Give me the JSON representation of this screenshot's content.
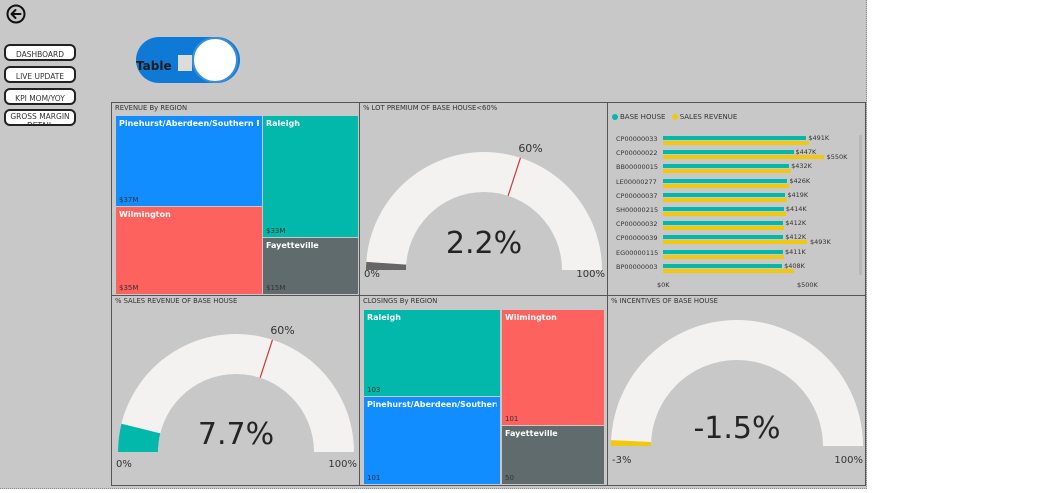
{
  "toggle": {
    "label": "Table"
  },
  "nav": [
    "DASHBOARD",
    "LIVE UPDATE",
    "KPI MOM/YOY",
    "GROSS MARGIN DETAIL"
  ],
  "revenue_by_region": {
    "title": "REVENUE By REGION",
    "tiles": [
      {
        "name": "Pinehurst/Aberdeen/Southern Pi...",
        "value": "$37M",
        "color": "#118dff"
      },
      {
        "name": "Raleigh",
        "value": "$33M",
        "color": "#01b8aa"
      },
      {
        "name": "Wilmington",
        "value": "$35M",
        "color": "#fd625e"
      },
      {
        "name": "Fayetteville",
        "value": "$15M",
        "color": "#5f6b6d"
      }
    ]
  },
  "lot_premium": {
    "title": "% LOT PREMIUM OF BASE HOUSE<60%",
    "value": "2.2%",
    "target": "60%",
    "min": "0%",
    "max": "100%",
    "fraction": 0.022,
    "target_fraction": 0.6,
    "fill": "#666666"
  },
  "sales_revenue_pct": {
    "title": "% SALES REVENUE OF BASE HOUSE",
    "value": "7.7%",
    "target": "60%",
    "min": "0%",
    "max": "100%",
    "fraction": 0.077,
    "target_fraction": 0.6,
    "fill": "#01b8aa"
  },
  "incentives": {
    "title": "% INCENTIVES OF BASE HOUSE",
    "value": "-1.5%",
    "min": "-3%",
    "max": "100%",
    "fraction": 0.015,
    "fill": "#f2c80f"
  },
  "closings_by_region": {
    "title": "CLOSINGS By REGION",
    "tiles": [
      {
        "name": "Raleigh",
        "value": "103",
        "color": "#01b8aa"
      },
      {
        "name": "Wilmington",
        "value": "101",
        "color": "#fd625e"
      },
      {
        "name": "Pinehurst/Aberdeen/Southern ...",
        "value": "101",
        "color": "#118dff"
      },
      {
        "name": "Fayetteville",
        "value": "50",
        "color": "#5f6b6d"
      }
    ]
  },
  "chart_data": {
    "type": "bar",
    "orientation": "horizontal",
    "legend_position": "top-left",
    "categories": [
      "CP00000033",
      "CP00000022",
      "BB00000015",
      "LE00000277",
      "CP00000037",
      "SH00000215",
      "CP00000032",
      "CP00000039",
      "EG00000115",
      "BP00000003"
    ],
    "series": [
      {
        "name": "BASE HOUSE",
        "color": "#01b8aa",
        "values": [
          491,
          447,
          432,
          426,
          419,
          414,
          412,
          412,
          411,
          408
        ],
        "labels": [
          "$491K",
          "$447K",
          "$432K",
          "$426K",
          "$419K",
          "$414K",
          "$412K",
          "$412K",
          "$411K",
          "$408K"
        ]
      },
      {
        "name": "SALES REVENUE",
        "color": "#f2c80f",
        "values": [
          500,
          550,
          440,
          430,
          425,
          420,
          415,
          493,
          415,
          450
        ],
        "labels": [
          "",
          "$550K",
          "",
          "",
          "",
          "",
          "",
          "$493K",
          "",
          ""
        ]
      }
    ],
    "xlim": [
      0,
      560
    ],
    "xticks": [
      "$0K",
      "$500K"
    ]
  }
}
